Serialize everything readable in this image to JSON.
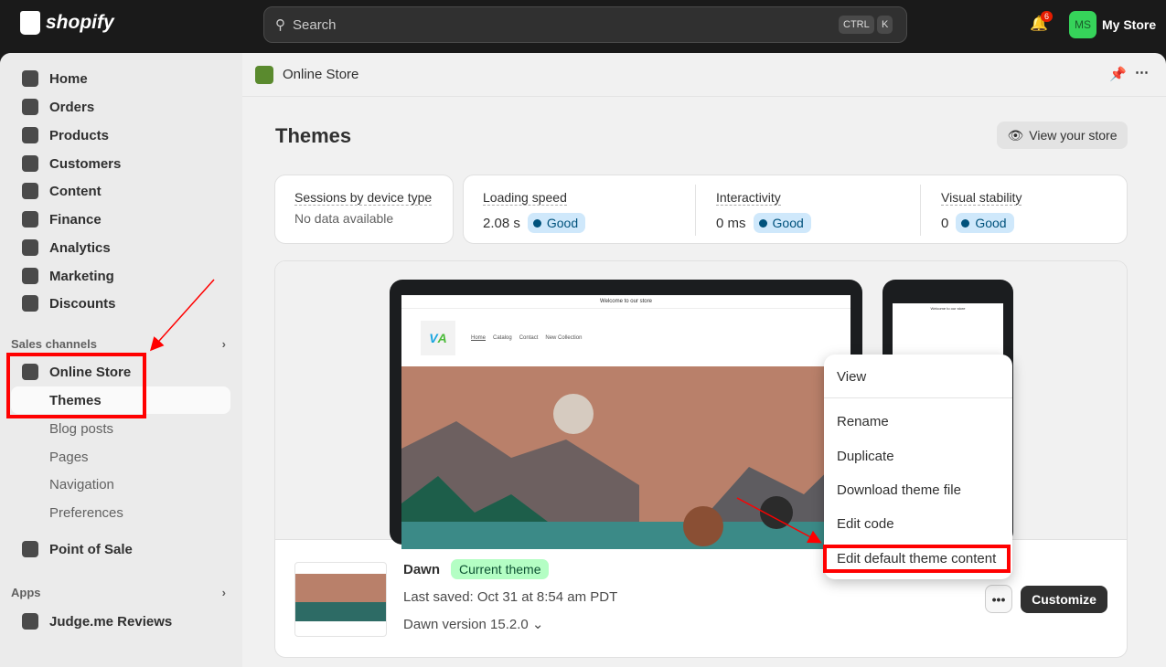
{
  "topbar": {
    "brand": "shopify",
    "search_placeholder": "Search",
    "kbd1": "CTRL",
    "kbd2": "K",
    "notifications": "6",
    "avatar_initials": "MS",
    "store_name": "My Store"
  },
  "sidebar": {
    "items": [
      {
        "label": "Home"
      },
      {
        "label": "Orders"
      },
      {
        "label": "Products"
      },
      {
        "label": "Customers"
      },
      {
        "label": "Content"
      },
      {
        "label": "Finance"
      },
      {
        "label": "Analytics"
      },
      {
        "label": "Marketing"
      },
      {
        "label": "Discounts"
      }
    ],
    "sales_channels": "Sales channels",
    "online_store": "Online Store",
    "sub": [
      {
        "label": "Themes"
      },
      {
        "label": "Blog posts"
      },
      {
        "label": "Pages"
      },
      {
        "label": "Navigation"
      },
      {
        "label": "Preferences"
      }
    ],
    "pos": "Point of Sale",
    "apps": "Apps",
    "judge": "Judge.me Reviews"
  },
  "header": {
    "breadcrumb": "Online Store",
    "title": "Themes",
    "view_store": "View your store"
  },
  "metrics": {
    "sessions_label": "Sessions by device type",
    "sessions_value": "No data available",
    "items": [
      {
        "label": "Loading speed",
        "value": "2.08 s",
        "status": "Good"
      },
      {
        "label": "Interactivity",
        "value": "0 ms",
        "status": "Good"
      },
      {
        "label": "Visual stability",
        "value": "0",
        "status": "Good"
      }
    ]
  },
  "preview": {
    "announcement": "Welcome to our store",
    "nav": [
      "Home",
      "Catalog",
      "Contact",
      "New Collection"
    ]
  },
  "theme": {
    "name": "Dawn",
    "badge": "Current theme",
    "last_saved": "Last saved: Oct 31 at 8:54 am PDT",
    "version": "Dawn version 15.2.0",
    "customize": "Customize",
    "more": "•••"
  },
  "menu": {
    "items": [
      "View",
      "Rename",
      "Duplicate",
      "Download theme file",
      "Edit code",
      "Edit default theme content"
    ]
  },
  "colors": {
    "accent": "#36d35a",
    "annotation": "#ff0000",
    "good": "#cfe8fb"
  }
}
